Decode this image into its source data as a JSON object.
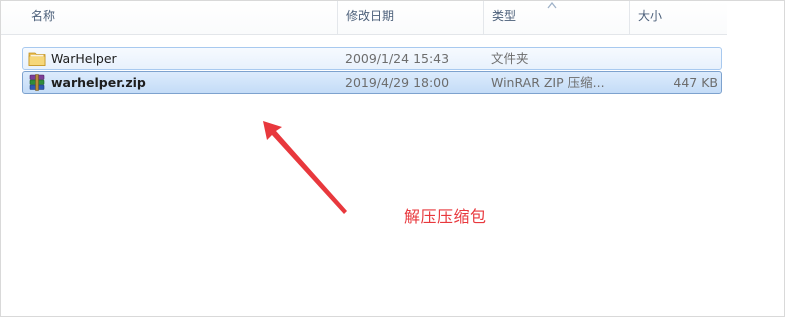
{
  "columns": {
    "name": "名称",
    "date": "修改日期",
    "type": "类型",
    "size": "大小"
  },
  "files": [
    {
      "name": "WarHelper",
      "date": "2009/1/24 15:43",
      "type": "文件夹",
      "size": "",
      "icon": "folder-icon"
    },
    {
      "name": "warhelper.zip",
      "date": "2019/4/29 18:00",
      "type": "WinRAR ZIP 压缩...",
      "size": "447 KB",
      "icon": "winrar-archive-icon"
    }
  ],
  "annotation": {
    "text": "解压压缩包",
    "color": "#e8383d"
  },
  "colors": {
    "header_text": "#4c607a",
    "selection_border": "#7da2ce",
    "selection_fill": "#cfe3f9"
  }
}
